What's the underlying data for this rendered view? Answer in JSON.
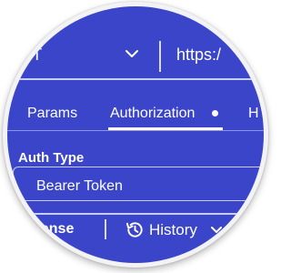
{
  "request": {
    "method": "ET",
    "url": "https:/"
  },
  "tabs": [
    {
      "label": "Params"
    },
    {
      "label": "Authorization"
    },
    {
      "label": "H"
    }
  ],
  "auth": {
    "type_label": "Auth Type",
    "selected_value": "Bearer Token"
  },
  "bottom_bar": {
    "response_label": "onse",
    "history_label": "History"
  },
  "icons": {
    "method_dropdown": "chevron-down-icon",
    "history": "history-icon",
    "history_dropdown": "chevron-down-icon"
  },
  "colors": {
    "background": "#3a45c9",
    "text": "#ffffff",
    "divider": "#c9cdfb"
  }
}
